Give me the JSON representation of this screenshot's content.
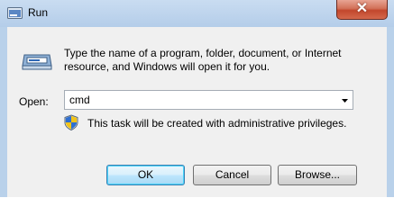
{
  "window": {
    "title": "Run",
    "close_label": "✕"
  },
  "dialog": {
    "description": "Type the name of a program, folder, document, or Internet resource, and Windows will open it for you.",
    "open_label": "Open:",
    "open_value": "cmd",
    "admin_note": "This task will be created with administrative privileges."
  },
  "buttons": {
    "ok": "OK",
    "cancel": "Cancel",
    "browse": "Browse..."
  },
  "icons": {
    "app": "run-icon",
    "program": "run-program-icon",
    "shield": "uac-shield-icon",
    "dropdown": "chevron-down-icon"
  }
}
